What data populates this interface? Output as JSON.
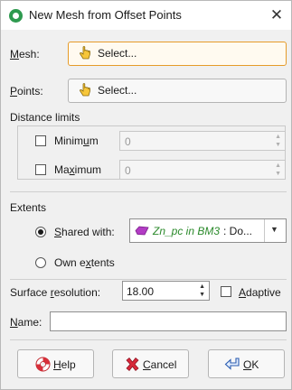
{
  "window": {
    "title": "New Mesh from Offset Points",
    "close_glyph": "✕"
  },
  "mesh": {
    "label": "Mesh:",
    "button": "Select..."
  },
  "points": {
    "label": "Points:",
    "button": "Select..."
  },
  "distance_limits": {
    "heading": "Distance limits",
    "minimum": {
      "label": "Minimum",
      "value": "0",
      "checked": false
    },
    "maximum": {
      "label": "Maximum",
      "value": "0",
      "checked": false
    }
  },
  "extents": {
    "heading": "Extents",
    "shared_with_label": "Shared with:",
    "shared_value_name": "Zn_pc in BM3",
    "shared_value_rest": ": Do...",
    "own_label": "Own extents",
    "selected": "shared"
  },
  "surface_resolution": {
    "label": "Surface resolution:",
    "value": "18.00"
  },
  "adaptive": {
    "label": "Adaptive",
    "checked": false
  },
  "name_field": {
    "label": "Name:",
    "value": ""
  },
  "buttons": {
    "help": "Help",
    "cancel": "Cancel",
    "ok": "OK"
  },
  "colors": {
    "accent_border": "#e69b2a",
    "shared_value_text": "#2b8a2b",
    "app_icon": "#2e9a4f"
  },
  "icons": [
    "app-icon",
    "close-icon",
    "hand-pointer-icon",
    "mesh-object-icon",
    "dropdown-arrow-icon",
    "help-lifebuoy-icon",
    "cancel-x-icon",
    "ok-arrow-icon"
  ]
}
